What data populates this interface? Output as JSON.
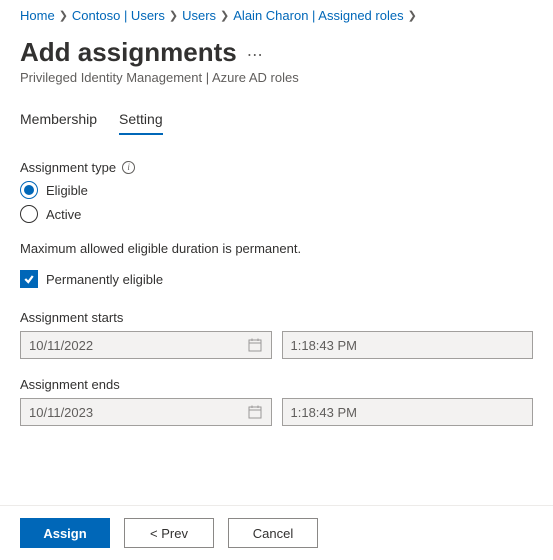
{
  "breadcrumb": [
    "Home",
    "Contoso | Users",
    "Users",
    "Alain Charon | Assigned roles"
  ],
  "header": {
    "title": "Add assignments",
    "subtitle": "Privileged Identity Management | Azure AD roles"
  },
  "tabs": {
    "membership": "Membership",
    "setting": "Setting"
  },
  "form": {
    "assignmentTypeLabel": "Assignment type",
    "radioEligible": "Eligible",
    "radioActive": "Active",
    "maxDurationNote": "Maximum allowed eligible duration is permanent.",
    "permEligibleLabel": "Permanently eligible",
    "startsLabel": "Assignment starts",
    "startsDate": "10/11/2022",
    "startsTime": "1:18:43 PM",
    "endsLabel": "Assignment ends",
    "endsDate": "10/11/2023",
    "endsTime": "1:18:43 PM"
  },
  "footer": {
    "assign": "Assign",
    "prev": "< Prev",
    "cancel": "Cancel"
  }
}
